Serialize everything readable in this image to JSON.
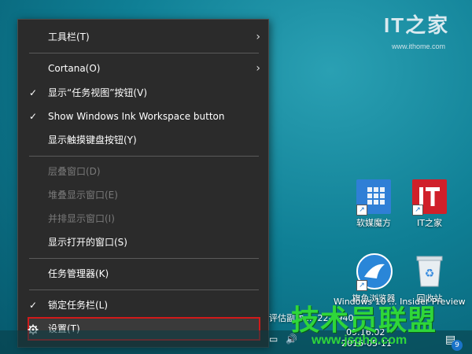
{
  "context_menu": {
    "items": [
      {
        "label": "工具栏(T)",
        "check": "",
        "arrow": "›"
      },
      {
        "label": "Cortana(O)",
        "check": "",
        "arrow": "›"
      },
      {
        "label": "显示“任务视图”按钮(V)",
        "check": "✓",
        "arrow": ""
      },
      {
        "label": "Show Windows Ink Workspace button",
        "check": "✓",
        "arrow": ""
      },
      {
        "label": "显示触摸键盘按钮(Y)",
        "check": "",
        "arrow": ""
      },
      {
        "label": "层叠窗口(D)",
        "check": "",
        "arrow": "",
        "disabled": true
      },
      {
        "label": "堆叠显示窗口(E)",
        "check": "",
        "arrow": "",
        "disabled": true
      },
      {
        "label": "并排显示窗口(I)",
        "check": "",
        "arrow": "",
        "disabled": true
      },
      {
        "label": "显示打开的窗口(S)",
        "check": "",
        "arrow": ""
      },
      {
        "label": "任务管理器(K)",
        "check": "",
        "arrow": ""
      },
      {
        "label": "锁定任务栏(L)",
        "check": "✓",
        "arrow": ""
      },
      {
        "label": "设置(T)",
        "check": "",
        "arrow": "",
        "icon": "gear-icon",
        "highlighted": true
      }
    ]
  },
  "watermark": {
    "logo": "IT之家",
    "url": "www.ithome.com"
  },
  "desktop_icons": [
    {
      "label": "软媒魔方",
      "icon": "rubik-cube-icon"
    },
    {
      "label": "IT之家",
      "icon": "ithome-icon"
    },
    {
      "label": "旗鱼浏览器",
      "icon": "sailfish-browser-icon"
    },
    {
      "label": "回收站",
      "icon": "recycle-bin-icon"
    }
  ],
  "windows_watermark": {
    "line1": "Windows 10 ... Insider Preview",
    "line2": "评估副本 ... 22-1940"
  },
  "taskbar": {
    "date": "2016-05-11",
    "time": "09:16:02",
    "notification_count": "9"
  },
  "site_brand": {
    "name": "技术员联盟",
    "url": "www.jsgho.com"
  },
  "colors": {
    "menu_bg": "#2b2b2b",
    "highlight_border": "#d11a1a",
    "brand_green": "#2fd63a"
  }
}
